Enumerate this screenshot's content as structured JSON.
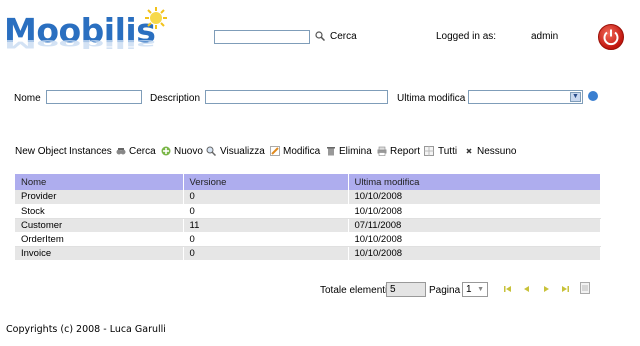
{
  "header": {
    "logo_text": "Moobilis",
    "search_value": "",
    "search_label": "Cerca",
    "logged_label": "Logged in as:",
    "user": "admin"
  },
  "filters": {
    "nome_label": "Nome",
    "description_label": "Description",
    "ultima_label": "Ultima modifica",
    "nome_value": "",
    "description_value": "",
    "ultima_value": ""
  },
  "toolbar": {
    "new_object": "New Object",
    "instances": "Instances",
    "cerca": "Cerca",
    "nuovo": "Nuovo",
    "visualizza": "Visualizza",
    "modifica": "Modifica",
    "elimina": "Elimina",
    "report": "Report",
    "tutti": "Tutti",
    "nessuno": "Nessuno"
  },
  "table": {
    "columns": [
      "Nome",
      "Versione",
      "Ultima modifica"
    ],
    "rows": [
      [
        "Provider",
        "0",
        "10/10/2008"
      ],
      [
        "Stock",
        "0",
        "10/10/2008"
      ],
      [
        "Customer",
        "11",
        "07/11/2008"
      ],
      [
        "OrderItem",
        "0",
        "10/10/2008"
      ],
      [
        "Invoice",
        "0",
        "10/10/2008"
      ]
    ]
  },
  "pager": {
    "total_label": "Totale elementi",
    "total_value": "5",
    "page_label": "Pagina",
    "page_value": "1"
  },
  "footer": {
    "copyright": "Copyrights (c) 2008 - Luca Garulli"
  }
}
